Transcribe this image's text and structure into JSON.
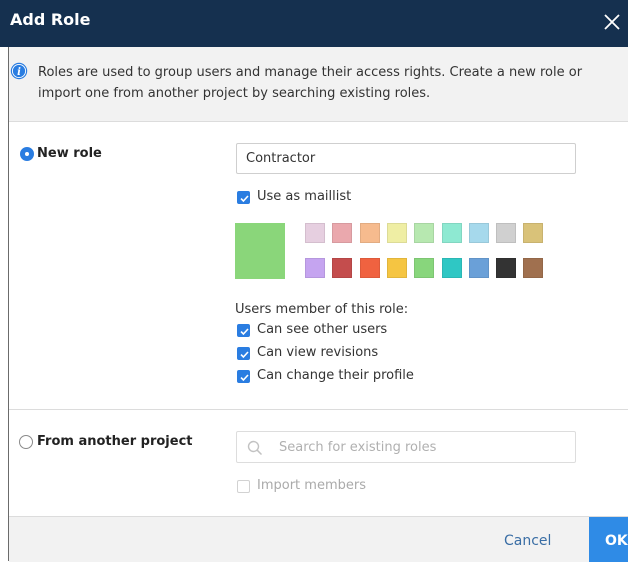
{
  "dialog": {
    "title": "Add Role",
    "close_icon": "close-icon"
  },
  "info": {
    "icon": "info-icon",
    "text": "Roles are used to group users and manage their access rights. Create a new role or import one from another project by searching existing roles."
  },
  "new_role": {
    "label": "New role",
    "selected": true,
    "name_value": "Contractor",
    "maillist_label": "Use as maillist",
    "maillist_checked": true,
    "selected_color": "#8ad67a",
    "palette_row1": [
      "#e6cfe0",
      "#eaa8ad",
      "#f6bb8e",
      "#efeea4",
      "#b7e8b0",
      "#8ee9d2",
      "#a6d9ec",
      "#d0d0d0",
      "#d9c279"
    ],
    "palette_row2": [
      "#c5a4f0",
      "#c44d4d",
      "#f06240",
      "#f5c542",
      "#88d67c",
      "#2fc7c4",
      "#6aa0d8",
      "#333333",
      "#a0704f"
    ],
    "members_title": "Users member of this role:",
    "permissions": [
      {
        "label": "Can see other users",
        "checked": true
      },
      {
        "label": "Can view revisions",
        "checked": true
      },
      {
        "label": "Can change their profile",
        "checked": true
      }
    ]
  },
  "other_project": {
    "label": "From another project",
    "selected": false,
    "search_placeholder": "Search for existing roles",
    "search_icon": "search-icon",
    "import_label": "Import members",
    "import_checked": false
  },
  "footer": {
    "cancel_label": "Cancel",
    "ok_label": "OK"
  },
  "colors": {
    "titlebar": "#15304f",
    "accent": "#2a7de1",
    "ok_button": "#2f8be6"
  }
}
